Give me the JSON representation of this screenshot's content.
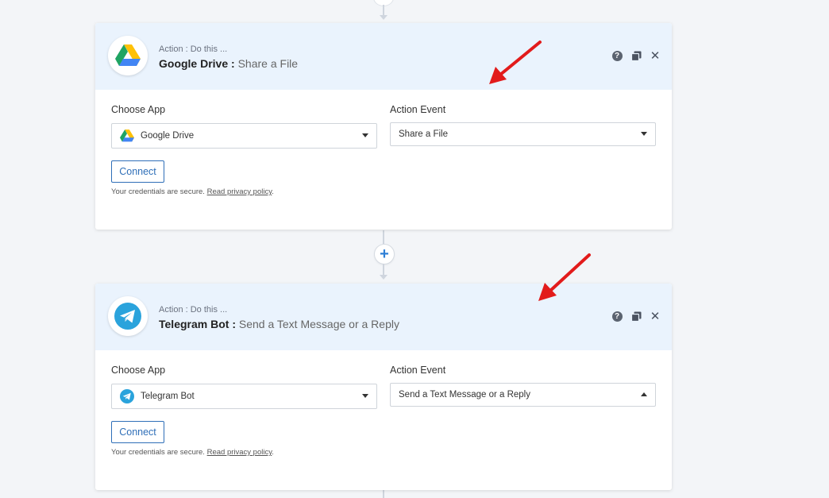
{
  "steps": [
    {
      "label": "Action : Do this ...",
      "app_name": "Google Drive",
      "separator": " : ",
      "event_name": "Share a File",
      "choose_app_label": "Choose App",
      "action_event_label": "Action Event",
      "app_value": "Google Drive",
      "event_value": "Share a File",
      "connect_label": "Connect",
      "secure_text": "Your credentials are secure.",
      "privacy_link": "Read privacy policy",
      "period": ".",
      "logo": "google-drive-logo"
    },
    {
      "label": "Action : Do this ...",
      "app_name": "Telegram Bot",
      "separator": " : ",
      "event_name": "Send a Text Message or a Reply",
      "choose_app_label": "Choose App",
      "action_event_label": "Action Event",
      "app_value": "Telegram Bot",
      "event_value": "Send a Text Message or a Reply",
      "connect_label": "Connect",
      "secure_text": "Your credentials are secure.",
      "privacy_link": "Read privacy policy",
      "period": ".",
      "logo": "telegram-logo"
    }
  ],
  "add_step_symbol": "+",
  "help_symbol": "?",
  "close_symbol": "✕",
  "colors": {
    "header_bg": "#eaf3fd",
    "accent": "#2f6fb8",
    "annotation_arrow": "#e21b1b",
    "telegram": "#2aa3dc"
  }
}
